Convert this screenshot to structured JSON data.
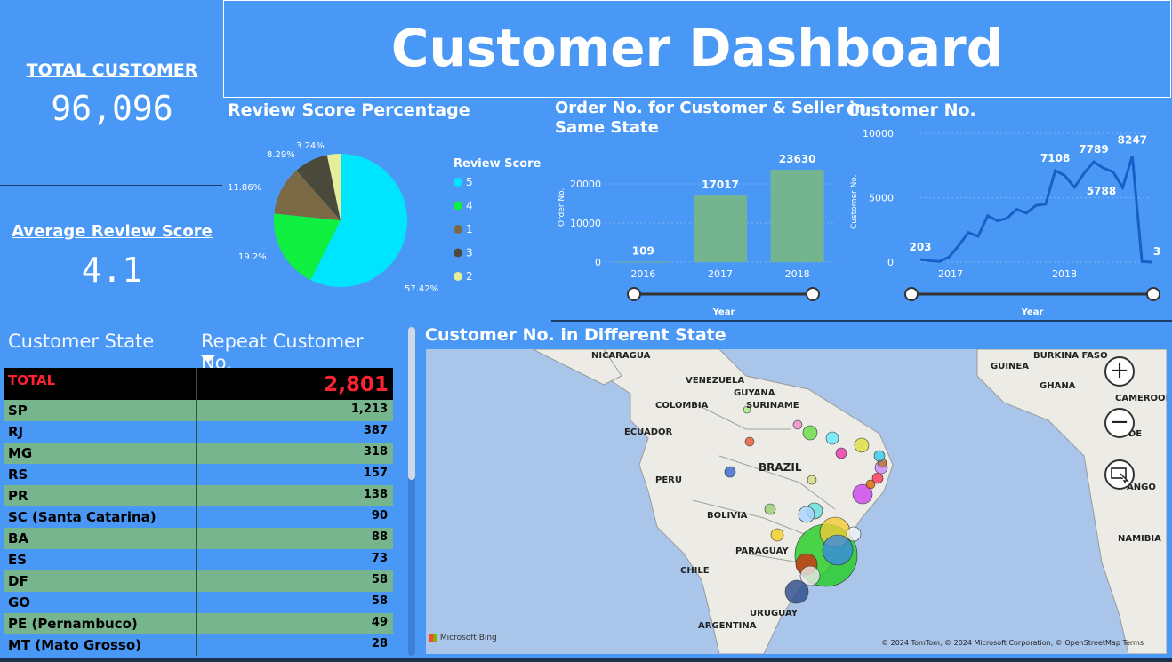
{
  "kpi": {
    "total_label": "TOTAL CUSTOMER",
    "total_value": "96,096",
    "avg_label": "Average Review Score",
    "avg_value": "4.1"
  },
  "title": "Customer Dashboard",
  "pie": {
    "title": "Review Score Percentage",
    "legend_title": "Review Score",
    "legend": [
      "5",
      "4",
      "1",
      "3",
      "2"
    ],
    "colors": [
      "#00e5ff",
      "#10f040",
      "#7b6a45",
      "#4a4a3a",
      "#e6ee9a"
    ],
    "values": [
      57.42,
      19.2,
      11.86,
      8.29,
      3.24
    ],
    "labels": [
      "57.42%",
      "19.2%",
      "11.86%",
      "8.29%",
      "3.24%"
    ]
  },
  "bar": {
    "title_line1": "Order No. for Customer & Seller in",
    "title_line2": "Same State",
    "ylabel": "Order No.",
    "xlabel": "Year",
    "yticks": [
      "20000",
      "10000",
      "0"
    ],
    "categories": [
      "2016",
      "2017",
      "2018"
    ],
    "value_labels": [
      "109",
      "17017",
      "23630"
    ]
  },
  "line": {
    "title": "Customer No.",
    "ylabel": "Customer No.",
    "xlabel": "Year",
    "yticks": [
      "10000",
      "5000",
      "0"
    ],
    "xticks": [
      "2017",
      "2018"
    ],
    "labels": [
      "203",
      "7108",
      "7789",
      "8247",
      "5788",
      "3"
    ]
  },
  "chart_data": [
    {
      "type": "pie",
      "title": "Review Score Percentage",
      "legend_title": "Review Score",
      "categories": [
        "5",
        "4",
        "1",
        "3",
        "2"
      ],
      "values": [
        57.42,
        19.2,
        11.86,
        8.29,
        3.24
      ]
    },
    {
      "type": "bar",
      "title": "Order No. for Customer & Seller in Same State",
      "xlabel": "Year",
      "ylabel": "Order No.",
      "categories": [
        "2016",
        "2017",
        "2018"
      ],
      "values": [
        109,
        17017,
        23630
      ],
      "ylim": [
        0,
        25000
      ]
    },
    {
      "type": "line",
      "title": "Customer No.",
      "xlabel": "Year",
      "ylabel": "Customer No.",
      "x": [
        "2016-09",
        "2016-10",
        "2016-12",
        "2017-01",
        "2017-02",
        "2017-03",
        "2017-04",
        "2017-05",
        "2017-06",
        "2017-07",
        "2017-08",
        "2017-09",
        "2017-10",
        "2017-11",
        "2017-12",
        "2018-01",
        "2018-02",
        "2018-03",
        "2018-04",
        "2018-05",
        "2018-06",
        "2018-07",
        "2018-08",
        "2018-09",
        "2018-10"
      ],
      "values": [
        203,
        100,
        50,
        400,
        1300,
        2300,
        2000,
        3600,
        3200,
        3400,
        4100,
        3800,
        4400,
        4500,
        7108,
        6700,
        5800,
        6900,
        7789,
        7300,
        7000,
        5788,
        8247,
        50,
        3
      ],
      "ylim": [
        0,
        10000
      ]
    }
  ],
  "table": {
    "col1": "Customer State",
    "col2": "Repeat Customer No.",
    "total_label": "TOTAL",
    "total_value": "2,801",
    "rows": [
      {
        "state": "SP",
        "value": "1,213"
      },
      {
        "state": "RJ",
        "value": "387"
      },
      {
        "state": "MG",
        "value": "318"
      },
      {
        "state": "RS",
        "value": "157"
      },
      {
        "state": "PR",
        "value": "138"
      },
      {
        "state": "SC (Santa Catarina)",
        "value": "90"
      },
      {
        "state": "BA",
        "value": "88"
      },
      {
        "state": "ES",
        "value": "73"
      },
      {
        "state": "DF",
        "value": "58"
      },
      {
        "state": "GO",
        "value": "58"
      },
      {
        "state": "PE (Pernambuco)",
        "value": "49"
      },
      {
        "state": "MT (Mato Grosso)",
        "value": "28"
      }
    ]
  },
  "map": {
    "title": "Customer No. in Different State",
    "labels": [
      "NICARAGUA",
      "VENEZUELA",
      "GUYANA",
      "SURINAME",
      "COLOMBIA",
      "ECUADOR",
      "BRAZIL",
      "PERU",
      "BOLIVIA",
      "PARAGUAY",
      "CHILE",
      "URUGUAY",
      "ARGENTINA",
      "GUINEA",
      "BURKINA FASO",
      "GHANA",
      "CAMEROON",
      "ANGO",
      "NAMIBIA",
      "DE"
    ],
    "attribution": "© 2024 TomTom, © 2024 Microsoft Corporation, © OpenStreetMap  Terms",
    "bing": "Microsoft Bing",
    "zoom_in": "+",
    "zoom_out": "−"
  }
}
